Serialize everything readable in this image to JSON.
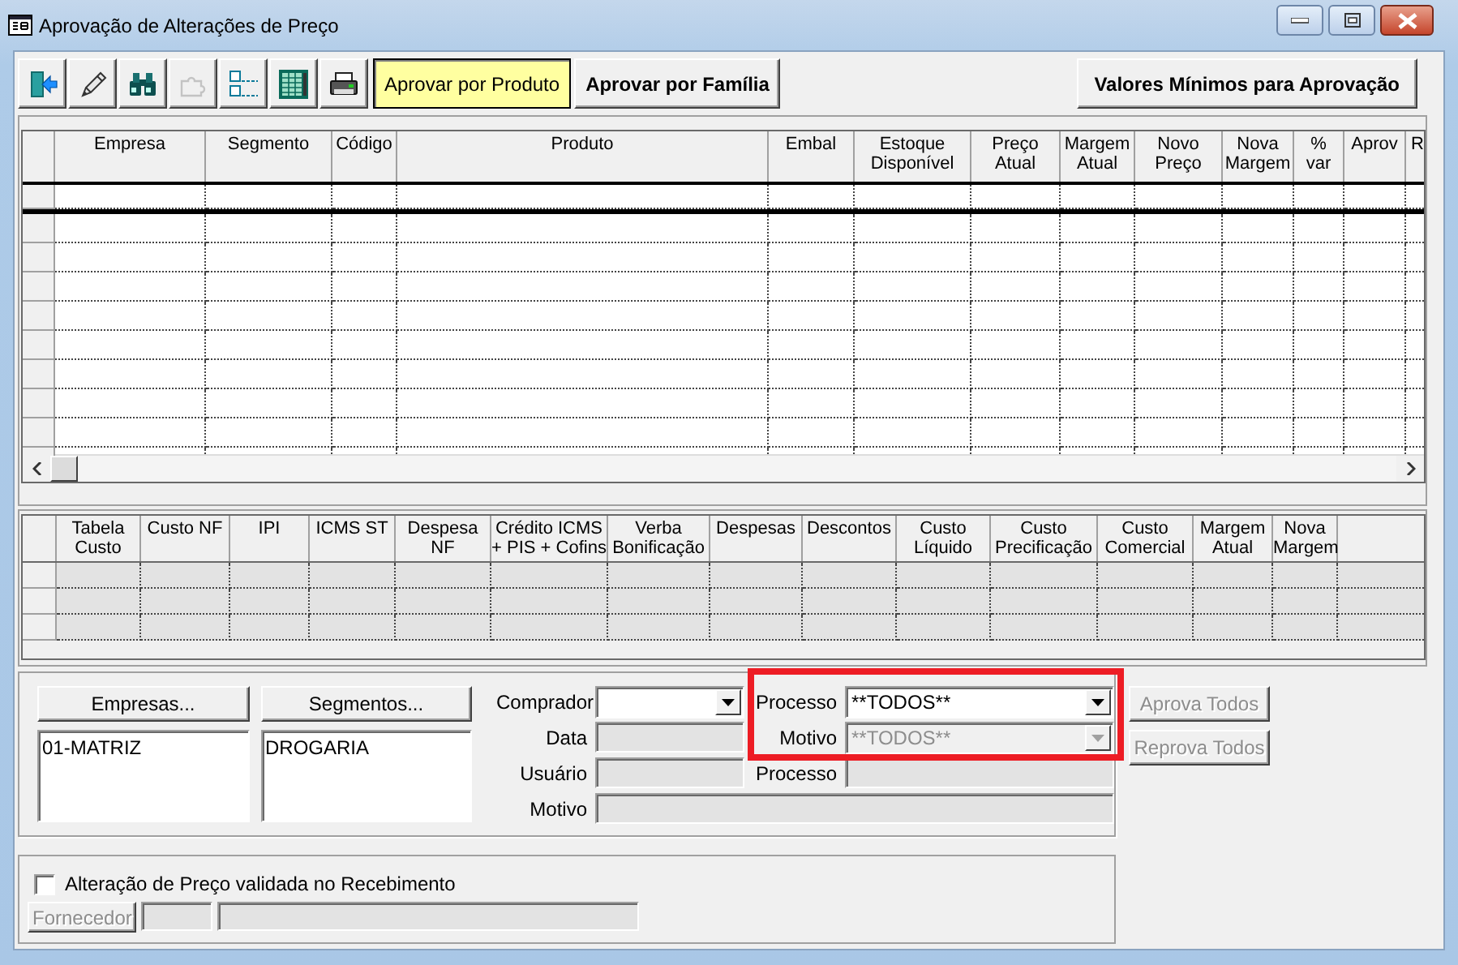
{
  "window": {
    "title": "Aprovação de Alterações de Preço"
  },
  "toolbar": {
    "icon_buttons": [
      {
        "kind": "exit",
        "disabled": false
      },
      {
        "kind": "edit",
        "disabled": false
      },
      {
        "kind": "search",
        "disabled": false
      },
      {
        "kind": "puzzle",
        "disabled": true
      },
      {
        "kind": "list",
        "disabled": false
      },
      {
        "kind": "sheet",
        "disabled": false
      },
      {
        "kind": "print",
        "disabled": false
      }
    ],
    "mode_buttons": [
      {
        "label": "Aprovar por Produto",
        "selected": true
      },
      {
        "label": "Aprovar por Família",
        "selected": false
      }
    ],
    "minimum_values_button": "Valores Mínimos para Aprovação"
  },
  "products_grid": {
    "columns": [
      "Empresa",
      "Segmento",
      "Código",
      "Produto",
      "Embal",
      "Estoque\nDisponível",
      "Preço\nAtual",
      "Margem\nAtual",
      "Novo\nPreço",
      "Nova\nMargem",
      "%\nvar",
      "Aprov",
      "R"
    ],
    "rows": [
      {
        "selected": true
      },
      {
        "selected": false
      },
      {
        "selected": false
      },
      {
        "selected": false
      },
      {
        "selected": false
      },
      {
        "selected": false
      },
      {
        "selected": false
      },
      {
        "selected": false
      },
      {
        "selected": false
      },
      {
        "selected": false
      }
    ]
  },
  "costs_grid": {
    "columns": [
      "Tabela\nCusto",
      "Custo NF",
      "IPI",
      "ICMS ST",
      "Despesa\nNF",
      "Crédito ICMS\n+ PIS + Cofins",
      "Verba\nBonificação",
      "Despesas",
      "Descontos",
      "Custo\nLíquido",
      "Custo\nPrecificação",
      "Custo\nComercial",
      "Margem\nAtual",
      "Nova\nMargem"
    ]
  },
  "filters": {
    "empresas_button": "Empresas...",
    "empresas": [
      "01-MATRIZ"
    ],
    "segmentos_button": "Segmentos...",
    "segmentos": [
      "DROGARIA"
    ],
    "comprador": {
      "label": "Comprador"
    },
    "data": {
      "label": "Data"
    },
    "usuario": {
      "label": "Usuário"
    },
    "motivo": {
      "label": "Motivo"
    },
    "processo_filter": {
      "label": "Processo",
      "value": "**TODOS**",
      "disabled": false
    },
    "motivo_filter": {
      "label": "Motivo",
      "value": "**TODOS**",
      "disabled": true
    },
    "processo": {
      "label": "Processo"
    },
    "approve_all_button": {
      "label": "Aprova Todos",
      "disabled": true
    },
    "reject_all_button": {
      "label": "Reprova Todos",
      "disabled": true
    }
  },
  "receipt": {
    "checkbox": {
      "label": "Alteração de Preço validada no Recebimento",
      "checked": false
    },
    "fornecedor_button": {
      "label": "Fornecedor",
      "disabled": true
    }
  }
}
